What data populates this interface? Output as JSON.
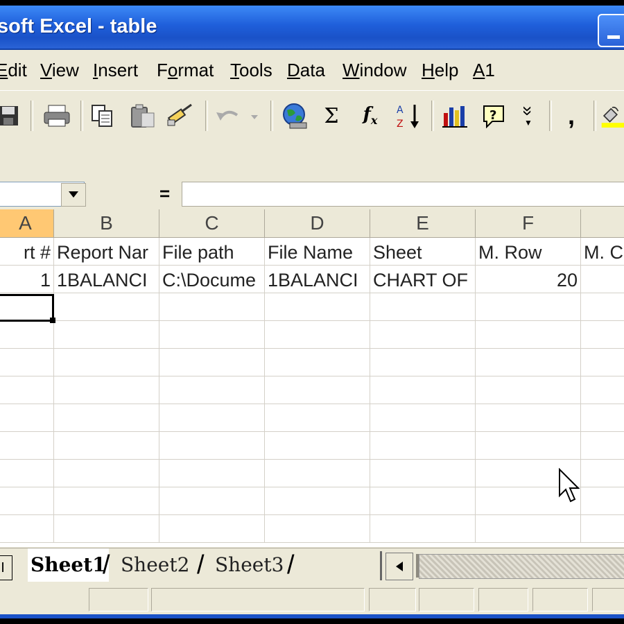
{
  "window": {
    "title": "soft Excel - table"
  },
  "menu": {
    "items": [
      {
        "pre": "",
        "ul": "E",
        "post": "dit"
      },
      {
        "pre": "",
        "ul": "V",
        "post": "iew"
      },
      {
        "pre": "",
        "ul": "I",
        "post": "nsert"
      },
      {
        "pre": "F",
        "ul": "o",
        "post": "rmat"
      },
      {
        "pre": "",
        "ul": "T",
        "post": "ools"
      },
      {
        "pre": "",
        "ul": "D",
        "post": "ata"
      },
      {
        "pre": "",
        "ul": "W",
        "post": "indow"
      },
      {
        "pre": "",
        "ul": "H",
        "post": "elp"
      },
      {
        "pre": "",
        "ul": "A",
        "post": "1"
      }
    ]
  },
  "toolbar": {
    "sigma": "Σ",
    "fx_f": "f",
    "fx_x": "x",
    "overflow": "»",
    "comma": ","
  },
  "formula_bar": {
    "equals": "="
  },
  "grid": {
    "columns": [
      "A",
      "B",
      "C",
      "D",
      "E",
      "F",
      ""
    ],
    "rows": [
      [
        "rt #",
        "Report Nar",
        "File path",
        "File Name",
        "Sheet",
        "M. Row",
        "M. C"
      ],
      [
        "1",
        "1BALANCI",
        "C:\\Docume",
        "1BALANCI",
        "CHART OF",
        "20",
        ""
      ]
    ]
  },
  "sheets": {
    "tabs": [
      "Sheet1",
      "Sheet2",
      "Sheet3"
    ],
    "active": "Sheet1",
    "nav_glyph": "I"
  },
  "colors": {
    "title_bar": "#1f5fdb",
    "chrome": "#ece9d8",
    "selected_header": "#ffc873"
  }
}
